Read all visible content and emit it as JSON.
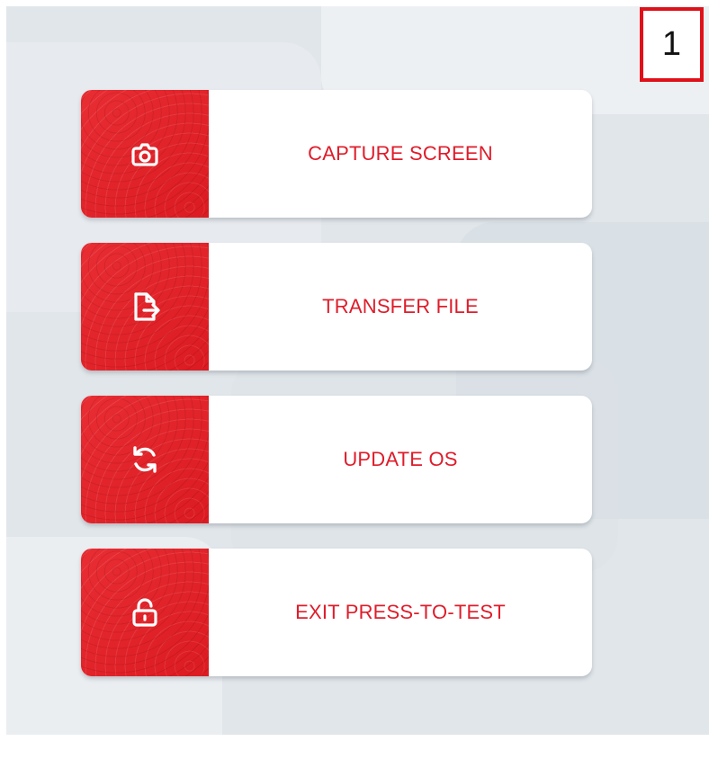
{
  "page_number": "1",
  "colors": {
    "background": "#e1e6ea",
    "accent": "#e61d24",
    "label": "#df1c2a",
    "card": "#ffffff",
    "page_number_border": "#e01019"
  },
  "menu": {
    "items": [
      {
        "label": "CAPTURE SCREEN",
        "icon": "camera-icon"
      },
      {
        "label": "TRANSFER FILE",
        "icon": "file-transfer-icon"
      },
      {
        "label": "UPDATE OS",
        "icon": "refresh-icon"
      },
      {
        "label": "EXIT PRESS-TO-TEST",
        "icon": "unlock-icon"
      }
    ]
  }
}
